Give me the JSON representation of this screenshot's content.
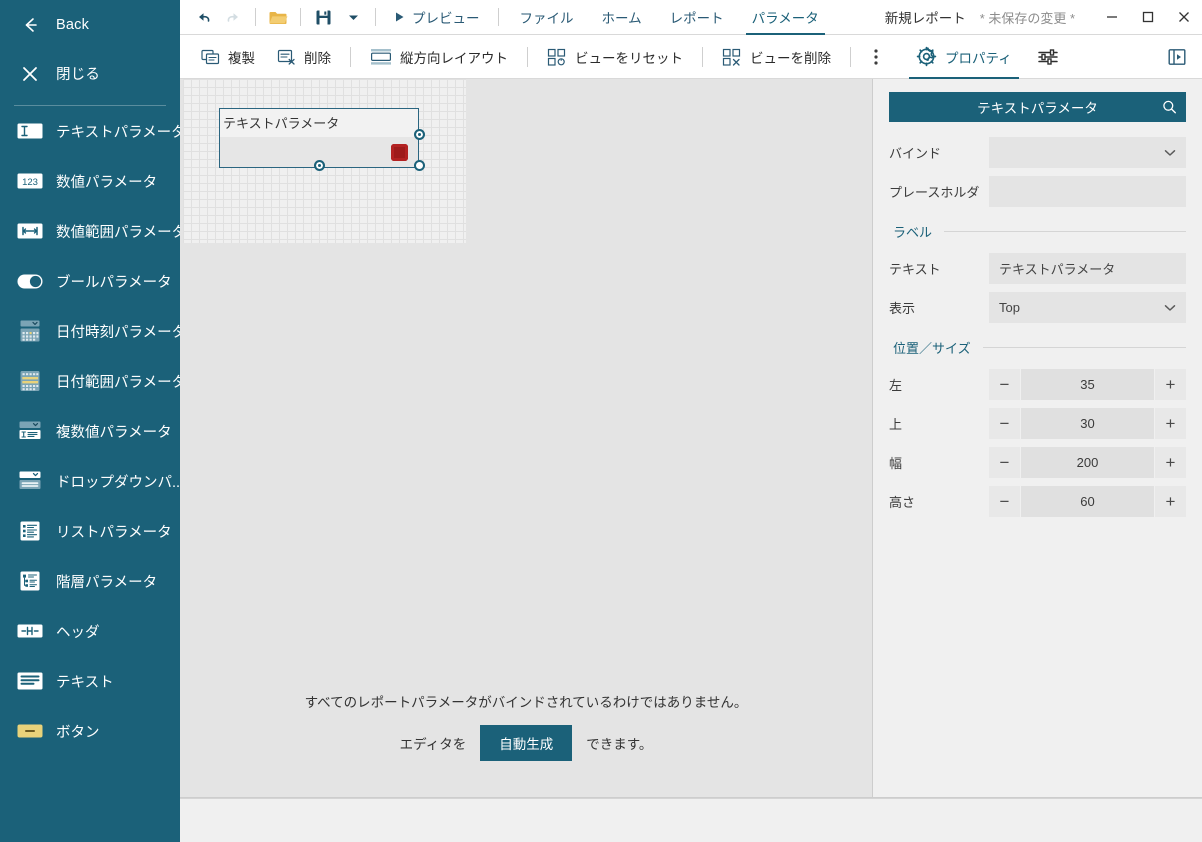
{
  "sidebar": {
    "top_items": [
      {
        "label": "Back",
        "icon": "arrow-left-icon",
        "name": "back"
      },
      {
        "label": "閉じる",
        "icon": "close-x-icon",
        "name": "close"
      }
    ],
    "items": [
      {
        "label": "テキストパラメータ",
        "icon": "text-parameter-icon"
      },
      {
        "label": "数値パラメータ",
        "icon": "number-parameter-icon"
      },
      {
        "label": "数値範囲パラメータ",
        "icon": "number-range-parameter-icon"
      },
      {
        "label": "ブールパラメータ",
        "icon": "toggle-parameter-icon"
      },
      {
        "label": "日付時刻パラメータ",
        "icon": "datetime-parameter-icon"
      },
      {
        "label": "日付範囲パラメータ",
        "icon": "date-range-parameter-icon"
      },
      {
        "label": "複数値パラメータ",
        "icon": "multivalue-parameter-icon"
      },
      {
        "label": "ドロップダウンパ...",
        "icon": "dropdown-parameter-icon"
      },
      {
        "label": "リストパラメータ",
        "icon": "list-parameter-icon"
      },
      {
        "label": "階層パラメータ",
        "icon": "hierarchy-parameter-icon"
      },
      {
        "label": "ヘッダ",
        "icon": "header-icon"
      },
      {
        "label": "テキスト",
        "icon": "text-icon"
      },
      {
        "label": "ボタン",
        "icon": "button-icon"
      }
    ]
  },
  "topbar": {
    "undo": "undo-icon",
    "redo": "redo-icon",
    "open": "open-folder-icon",
    "save": "save-disk-icon",
    "save_dropdown": "caret-down-icon",
    "preview_label": "プレビュー",
    "tabs": [
      {
        "label": "ファイル",
        "active": false
      },
      {
        "label": "ホーム",
        "active": false
      },
      {
        "label": "レポート",
        "active": false
      },
      {
        "label": "パラメータ",
        "active": true
      }
    ],
    "doc_title": "新規レポート",
    "doc_dirty": "* 未保存の変更 *",
    "window": {
      "minimize": "minimize-icon",
      "maximize": "maximize-icon",
      "close": "window-close-icon"
    }
  },
  "actionbar": {
    "duplicate_label": "複製",
    "delete_label": "削除",
    "layout_label": "縦方向レイアウト",
    "reset_view_label": "ビューをリセット",
    "delete_view_label": "ビューを削除",
    "overflow": "kebab-menu-icon",
    "properties_label": "プロパティ",
    "settings_icon": "sliders-icon",
    "panel_toggle_icon": "panel-toggle-icon"
  },
  "canvas": {
    "widget": {
      "label": "テキストパラメータ",
      "swatch_color": "#9e1b1b"
    },
    "notice": {
      "line1": "すべてのレポートパラメータがバインドされているわけではありません。",
      "prefix": "エディタを",
      "button": "自動生成",
      "suffix": "できます。"
    }
  },
  "properties": {
    "header_title": "テキストパラメータ",
    "search_icon": "search-icon",
    "fields": [
      {
        "label": "バインド",
        "value": "",
        "type": "select"
      },
      {
        "label": "プレースホルダ",
        "value": "",
        "type": "input"
      }
    ],
    "label_section": {
      "title": "ラベル",
      "text_label": "テキスト",
      "text_value": "テキストパラメータ",
      "display_label": "表示",
      "display_value": "Top"
    },
    "geometry_section": {
      "title": "位置／サイズ",
      "rows": [
        {
          "label": "左",
          "value": "35"
        },
        {
          "label": "上",
          "value": "30"
        },
        {
          "label": "幅",
          "value": "200"
        },
        {
          "label": "高さ",
          "value": "60"
        }
      ],
      "minus": "−",
      "plus": "+"
    }
  },
  "colors": {
    "accent": "#1b6179",
    "panel_bg": "#f0f0f0",
    "canvas_bg": "#e4e4e4",
    "swatch_red": "#9e1b1b",
    "button_yellow": "#e8d27a"
  }
}
